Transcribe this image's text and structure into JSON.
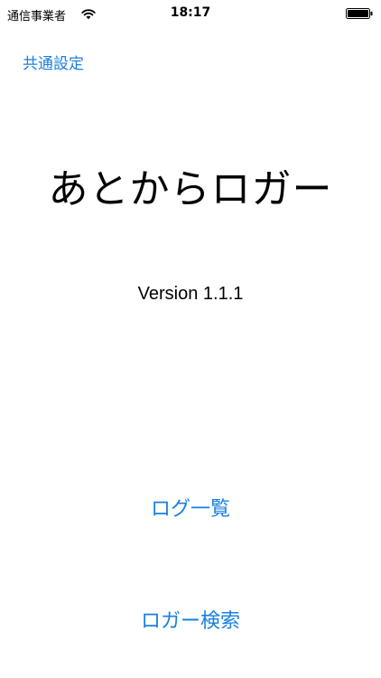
{
  "status_bar": {
    "carrier": "通信事業者",
    "wifi_icon": "wifi-icon",
    "time": "18:17",
    "battery_icon": "battery-full-icon"
  },
  "nav": {
    "settings_label": "共通設定"
  },
  "main": {
    "app_title": "あとからロガー",
    "version": "Version 1.1.1"
  },
  "actions": {
    "log_list_label": "ログ一覧",
    "logger_search_label": "ロガー検索"
  },
  "colors": {
    "accent": "#1a7fe0",
    "text": "#000000",
    "background": "#ffffff"
  }
}
